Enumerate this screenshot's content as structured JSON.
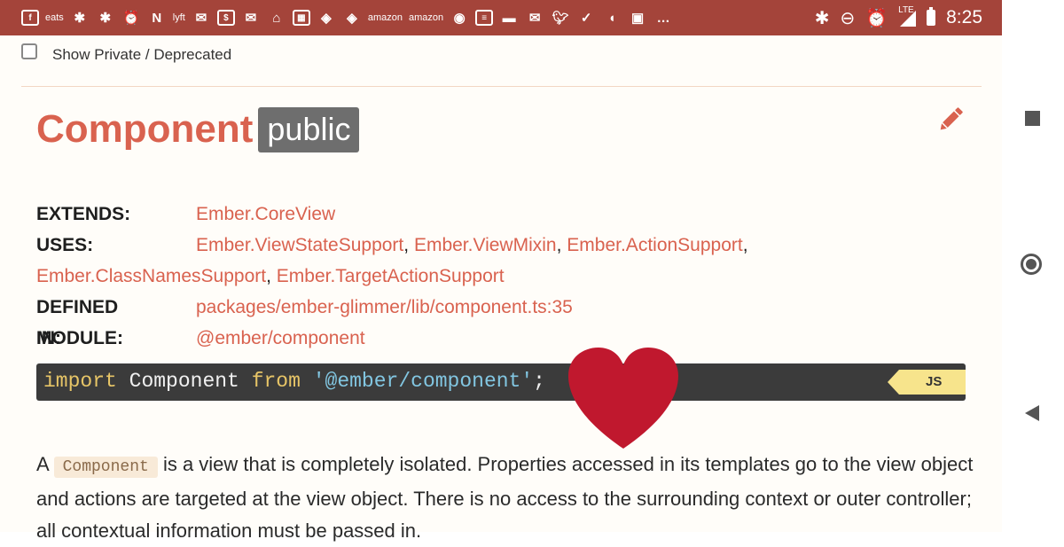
{
  "status_bar": {
    "icons": [
      "facebook-icon",
      "uber-eats-icon",
      "yelp-icon",
      "yelp-icon",
      "alarm-icon",
      "netflix-icon",
      "lyft-icon",
      "gmail-icon",
      "bank-icon",
      "gmail-icon",
      "home-icon",
      "calendar-icon",
      "maps-icon",
      "maps-icon",
      "amazon-icon",
      "amazon-icon",
      "firefox-icon",
      "news-icon",
      "hotel-icon",
      "mail-icon",
      "twitter-icon",
      "done-icon",
      "squirrel-icon",
      "photo-icon",
      "more-icon"
    ],
    "eats_label": "eats",
    "amazon_label": "amazon",
    "netflix_label": "N",
    "lyft_label": "lyft",
    "more_label": "…",
    "lte_label": "LTE",
    "time": "8:25"
  },
  "filter": {
    "checkbox_label": "Show Private / Deprecated"
  },
  "header": {
    "title": "Component",
    "badge": "public"
  },
  "meta": {
    "extends_label": "EXTENDS:",
    "extends_value": "Ember.CoreView",
    "uses_label": "USES:",
    "uses_values": [
      "Ember.ViewStateSupport",
      "Ember.ViewMixin",
      "Ember.ActionSupport",
      "Ember.ClassNamesSupport",
      "Ember.TargetActionSupport"
    ],
    "defined_label": "DEFINED IN:",
    "defined_value": "packages/ember-glimmer/lib/component.ts:35",
    "module_label": "MODULE:",
    "module_value": "@ember/component"
  },
  "code_block": {
    "keyword_import": "import",
    "identifier": "Component",
    "keyword_from": "from",
    "string": "'@ember/component'",
    "semicolon": ";",
    "lang_tag": "JS"
  },
  "description": {
    "prefix": "A",
    "inline_code": "Component",
    "text": "is a view that is completely isolated. Properties accessed in its templates go to the view object and actions are targeted at the view object. There is no access to the surrounding context or outer controller; all contextual information must be passed in."
  },
  "colors": {
    "status_bar": "#a4443a",
    "accent": "#d9624f",
    "badge": "#6e6e6e",
    "code_bg": "#3b3b3b",
    "heart": "#c0182e"
  }
}
